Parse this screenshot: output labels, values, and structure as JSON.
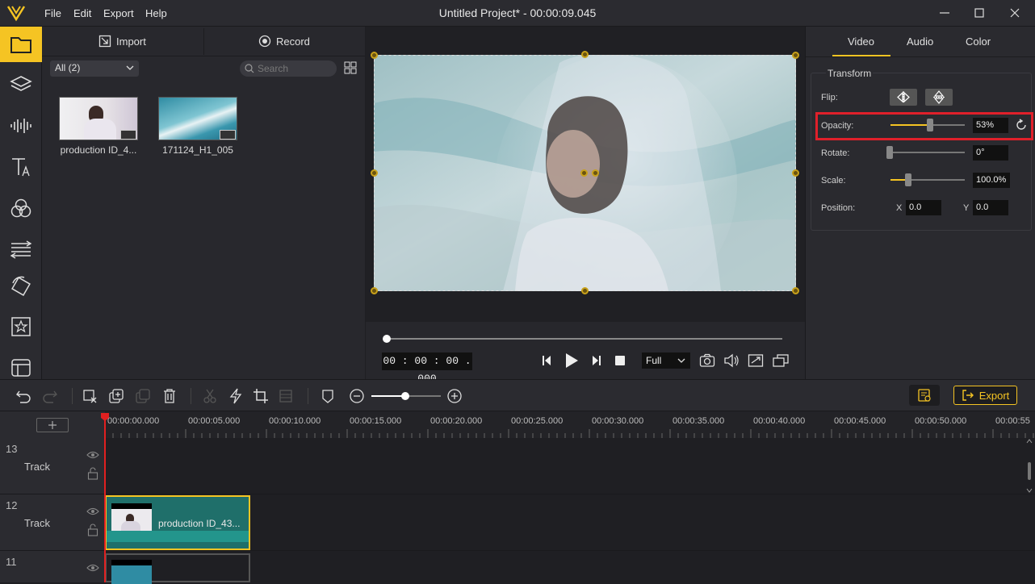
{
  "app": {
    "title": "Untitled Project* - 00:00:09.045"
  },
  "menu": [
    "File",
    "Edit",
    "Export",
    "Help"
  ],
  "media": {
    "import_label": "Import",
    "record_label": "Record",
    "filter_value": "All (2)",
    "search_placeholder": "Search",
    "items": [
      {
        "name": "production ID_4..."
      },
      {
        "name": "171124_H1_005"
      }
    ]
  },
  "preview": {
    "timecode": "00 : 00 : 00 . 000",
    "zoom": "Full",
    "progress": 0
  },
  "props": {
    "tabs": [
      "Video",
      "Audio",
      "Color"
    ],
    "active_tab": "Video",
    "section_title": "Transform",
    "flip_label": "Flip:",
    "opacity_label": "Opacity:",
    "opacity_value": "53%",
    "opacity_level": 0.53,
    "rotate_label": "Rotate:",
    "rotate_value": "0°",
    "scale_label": "Scale:",
    "scale_value": "100.0%",
    "position_label": "Position:",
    "x_label": "X",
    "x_value": "0.0",
    "y_label": "Y",
    "y_value": "0.0"
  },
  "toolbar": {
    "export_label": "Export"
  },
  "timeline": {
    "ruler": [
      "00:00:00.000",
      "00:00:05.000",
      "00:00:10.000",
      "00:00:15.000",
      "00:00:20.000",
      "00:00:25.000",
      "00:00:30.000",
      "00:00:35.000",
      "00:00:40.000",
      "00:00:45.000",
      "00:00:50.000",
      "00:00:55"
    ],
    "tracks": [
      {
        "num": "13",
        "name": "Track"
      },
      {
        "num": "12",
        "name": "Track"
      },
      {
        "num": "11",
        "name": ""
      }
    ],
    "clip_label": "production ID_43..."
  },
  "colors": {
    "accent": "#f5c423",
    "highlight": "#e0202a"
  }
}
